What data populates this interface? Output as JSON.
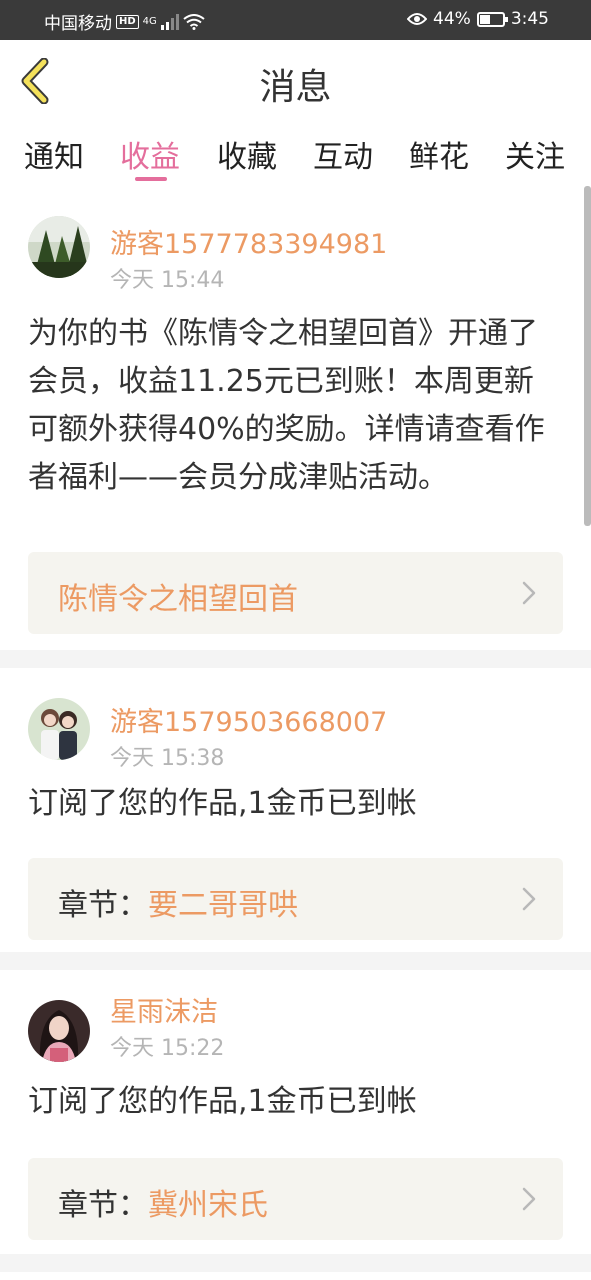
{
  "status_bar": {
    "carrier": "中国移动",
    "hd": "HD",
    "network": "4G",
    "battery_pct_text": "44%",
    "battery_level": 0.44,
    "time": "3:45"
  },
  "header": {
    "title": "消息"
  },
  "tabs": [
    {
      "label": "通知",
      "active": false
    },
    {
      "label": "收益",
      "active": true
    },
    {
      "label": "收藏",
      "active": false
    },
    {
      "label": "互动",
      "active": false
    },
    {
      "label": "鲜花",
      "active": false
    },
    {
      "label": "关注",
      "active": false
    }
  ],
  "messages": [
    {
      "username": "游客1577783394981",
      "time": "今天 15:44",
      "content": "为你的书《陈情令之相望回首》开通了会员，收益11.25元已到账！本周更新可额外获得40%的奖励。详情请查看作者福利——会员分成津贴活动。",
      "link_prefix": "",
      "link_title": "陈情令之相望回首"
    },
    {
      "username": "游客1579503668007",
      "time": "今天 15:38",
      "content": "订阅了您的作品,1金币已到帐",
      "link_prefix": "章节：",
      "link_title": "要二哥哥哄"
    },
    {
      "username": "星雨沫洁",
      "time": "今天 15:22",
      "content": "订阅了您的作品,1金币已到帐",
      "link_prefix": "章节：",
      "link_title": "冀州宋氏"
    }
  ],
  "colors": {
    "accent": "#e46e9c",
    "username": "#ec9a63",
    "link_box": "#f5f4ef"
  }
}
